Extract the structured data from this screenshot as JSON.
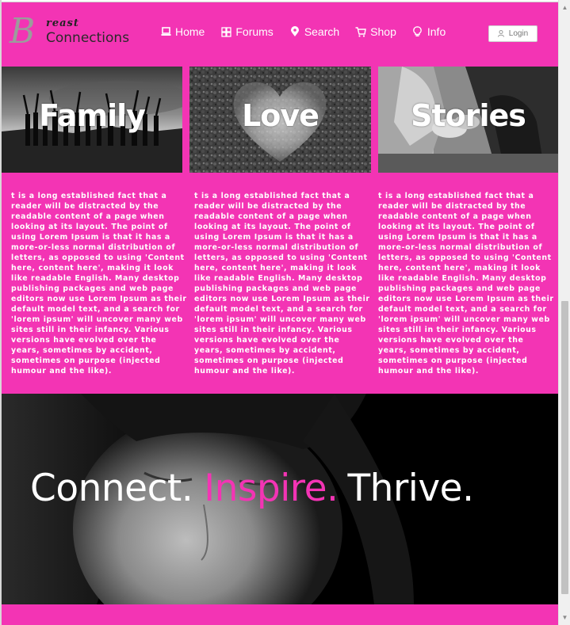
{
  "header": {
    "logo": {
      "script_text": "reast",
      "name": "Connections",
      "letter": "B"
    },
    "nav": [
      {
        "label": "Home",
        "icon": "laptop-icon"
      },
      {
        "label": "Forums",
        "icon": "puzzle-icon"
      },
      {
        "label": "Search",
        "icon": "map-pin-icon"
      },
      {
        "label": "Shop",
        "icon": "cart-icon"
      },
      {
        "label": "Info",
        "icon": "lightbulb-icon"
      }
    ],
    "login_label": "Login"
  },
  "cards": [
    {
      "title": "Family",
      "text": "t is a long established fact that a reader will be distracted by the readable content of a page when looking at its layout. The point of using Lorem Ipsum is that it has a more-or-less normal distribution of letters, as opposed to using 'Content here, content here', making it look like readable English. Many desktop publishing packages and web page editors now use Lorem Ipsum as their default model text, and a search for 'lorem ipsum' will uncover many web sites still in their infancy. Various versions have evolved over the years, sometimes by accident, sometimes on purpose (injected humour and the like)."
    },
    {
      "title": "Love",
      "text": "t is a long established fact that a reader will be distracted by the readable content of a page when looking at its layout. The point of using Lorem Ipsum is that it has a more-or-less normal distribution of letters, as opposed to using 'Content here, content here', making it look like readable English. Many desktop publishing packages and web page editors now use Lorem Ipsum as their default model text, and a search for 'lorem ipsum' will uncover many web sites still in their infancy. Various versions have evolved over the years, sometimes by accident, sometimes on purpose (injected humour and the like)."
    },
    {
      "title": "Stories",
      "text": "t is a long established fact that a reader will be distracted by the readable content of a page when looking at its layout. The point of using Lorem Ipsum is that it has a more-or-less normal distribution of letters, as opposed to using 'Content here, content here', making it look like readable English. Many desktop publishing packages and web page editors now use Lorem Ipsum as their default model text, and a search for 'lorem ipsum' will uncover many web sites still in their infancy. Various versions have evolved over the years, sometimes by accident, sometimes on purpose (injected humour and the like)."
    }
  ],
  "banner": {
    "tagline": [
      "Connect.",
      "Inspire.",
      "Thrive."
    ]
  },
  "colors": {
    "brand_pink": "#f334b4",
    "banner_bg": "#000000",
    "text_white": "#ffffff"
  }
}
